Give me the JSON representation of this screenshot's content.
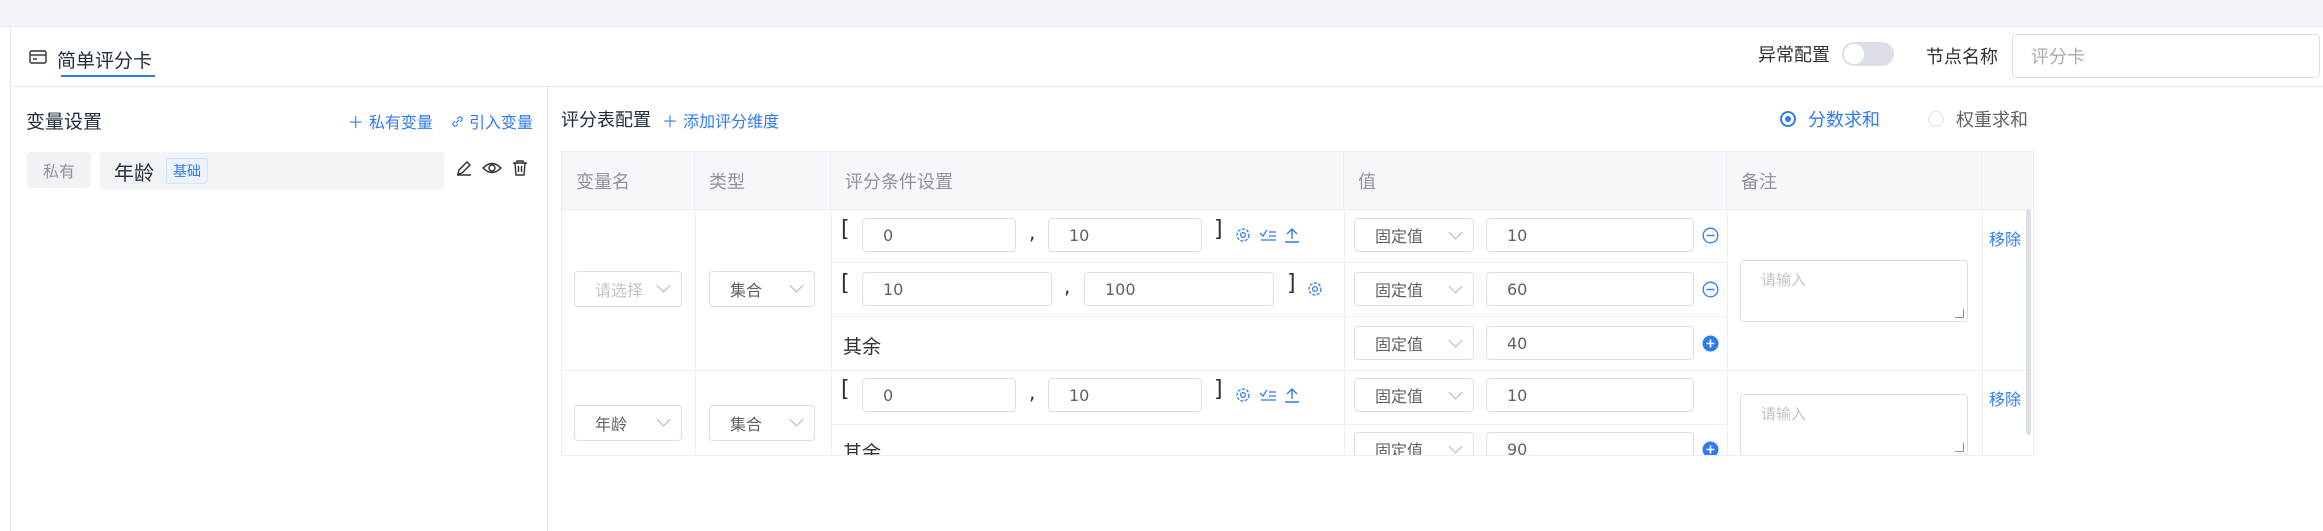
{
  "header": {
    "tab_label": "简单评分卡",
    "anomaly_label": "异常配置",
    "anomaly_on": false,
    "node_name_label": "节点名称",
    "node_name_value": "评分卡"
  },
  "left": {
    "title": "变量设置",
    "private_var_link": "私有变量",
    "import_var_link": "引入变量",
    "variables": [
      {
        "scope": "私有",
        "name": "年龄",
        "tag": "基础"
      }
    ]
  },
  "main": {
    "title": "评分表配置",
    "add_dimension": "添加评分维度",
    "modes": [
      {
        "label": "分数求和",
        "selected": true
      },
      {
        "label": "权重求和",
        "selected": false
      }
    ],
    "columns": [
      "变量名",
      "类型",
      "评分条件设置",
      "值",
      "备注"
    ],
    "placeholder_select": "请选择",
    "placeholder_remark": "请输入",
    "remove_label": "移除",
    "rest_label": "其余",
    "value_type": "固定值",
    "groups": [
      {
        "var_name": "",
        "type": "集合",
        "rows": [
          {
            "lo": "0",
            "hi": "10",
            "value": "10"
          },
          {
            "lo": "10",
            "hi": "100",
            "value": "60"
          },
          {
            "rest": true,
            "value": "40"
          }
        ]
      },
      {
        "var_name": "年龄",
        "type": "集合",
        "rows": [
          {
            "lo": "0",
            "hi": "10",
            "value": "10"
          },
          {
            "rest": true,
            "value": "90"
          }
        ]
      }
    ]
  },
  "colors": {
    "accent": "#2f7bf5",
    "border": "#dcdfe6"
  },
  "icons": [
    "card-icon",
    "plus-icon",
    "link-icon",
    "edit-icon",
    "eye-icon",
    "trash-icon",
    "gear-icon",
    "check-list-icon",
    "upload-icon",
    "minus-circle-icon",
    "plus-circle-icon"
  ]
}
